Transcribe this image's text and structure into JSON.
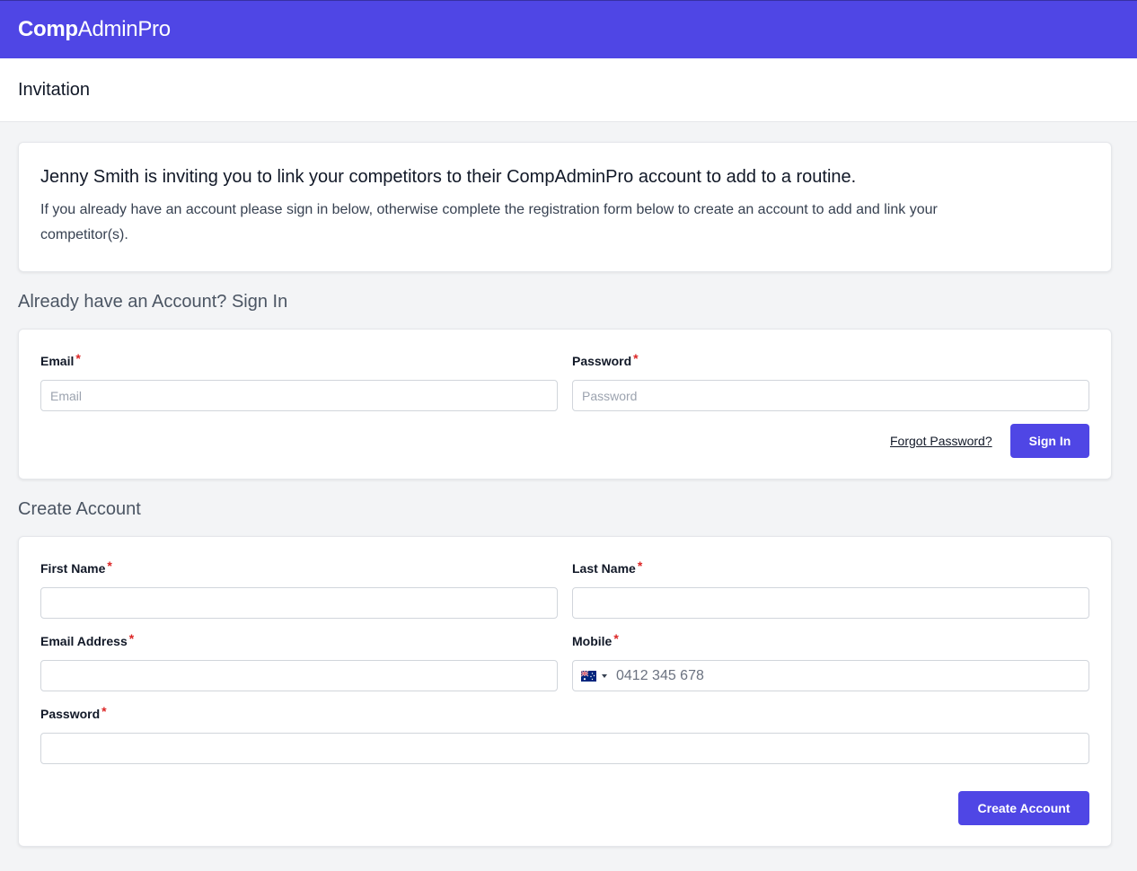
{
  "brand": {
    "name_bold": "Comp",
    "name_light": "AdminPro"
  },
  "colors": {
    "primary": "#4f46e5",
    "required": "#dc2626",
    "background": "#f3f4f6"
  },
  "page": {
    "title": "Invitation"
  },
  "invite": {
    "heading": "Jenny Smith is inviting you to link your competitors to their CompAdminPro account to add to a routine.",
    "body": "If you already have an account please sign in below, otherwise complete the registration form below to create an account to add and link your competitor(s)."
  },
  "signin": {
    "section_title": "Already have an Account? Sign In",
    "email_label": "Email",
    "email_placeholder": "Email",
    "email_value": "",
    "password_label": "Password",
    "password_placeholder": "Password",
    "password_value": "",
    "forgot_label": "Forgot Password?",
    "submit_label": "Sign In"
  },
  "create": {
    "section_title": "Create Account",
    "first_name_label": "First Name",
    "first_name_value": "",
    "last_name_label": "Last Name",
    "last_name_value": "",
    "email_label": "Email Address",
    "email_value": "",
    "mobile_label": "Mobile",
    "mobile_country": "AU",
    "mobile_country_icon": "australia-flag-icon",
    "mobile_placeholder": "0412 345 678",
    "mobile_value": "",
    "password_label": "Password",
    "password_value": "",
    "submit_label": "Create Account"
  },
  "required_marker": "*"
}
